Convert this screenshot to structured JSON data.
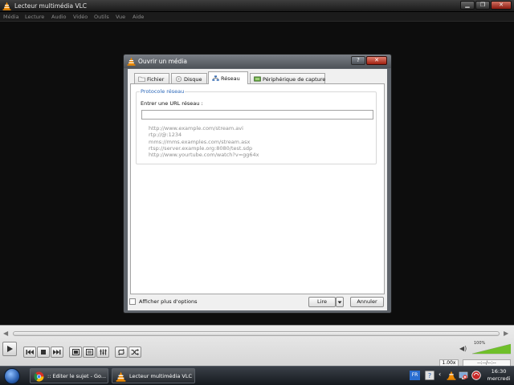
{
  "window": {
    "title": "Lecteur multimédia VLC",
    "buttons": {
      "minimize": "▁",
      "maximize": "❐",
      "close": "✕"
    }
  },
  "menu": [
    "Média",
    "Lecture",
    "Audio",
    "Vidéo",
    "Outils",
    "Vue",
    "Aide"
  ],
  "dialog": {
    "title": "Ouvrir un média",
    "help": "?",
    "close": "✕",
    "tabs": [
      {
        "label": "Fichier",
        "icon": "folder-icon",
        "active": false
      },
      {
        "label": "Disque",
        "icon": "disc-icon",
        "active": false
      },
      {
        "label": "Réseau",
        "icon": "network-icon",
        "active": true
      },
      {
        "label": "Périphérique de capture",
        "icon": "capture-device-icon",
        "active": false
      }
    ],
    "network": {
      "group_title": "Protocole réseau",
      "url_label": "Entrer une URL réseau :",
      "url_value": "",
      "examples": [
        "http://www.example.com/stream.avi",
        "rtp://@:1234",
        "mms://mms.examples.com/stream.asx",
        "rtsp://server.example.org:8080/test.sdp",
        "http://www.yourtube.com/watch?v=gg64x"
      ]
    },
    "more_options": "Afficher plus d'options",
    "play_button": "Lire",
    "cancel_button": "Annuler"
  },
  "player": {
    "volume_percent": "100%",
    "volume_level": 1.0,
    "speed": "1.00x",
    "time": "--:--/--:--"
  },
  "taskbar": {
    "tasks": [
      {
        "label": ":: Editer le sujet - Go...",
        "icon": "chrome-icon"
      },
      {
        "label": "Lecteur multimédia VLC",
        "icon": "vlc-icon"
      }
    ],
    "lang": "FR",
    "time": "16:30",
    "day": "mercredi"
  },
  "colors": {
    "vlc_orange": "#f08a00",
    "group_title_blue": "#2966b8",
    "close_red": "#c0392b"
  }
}
